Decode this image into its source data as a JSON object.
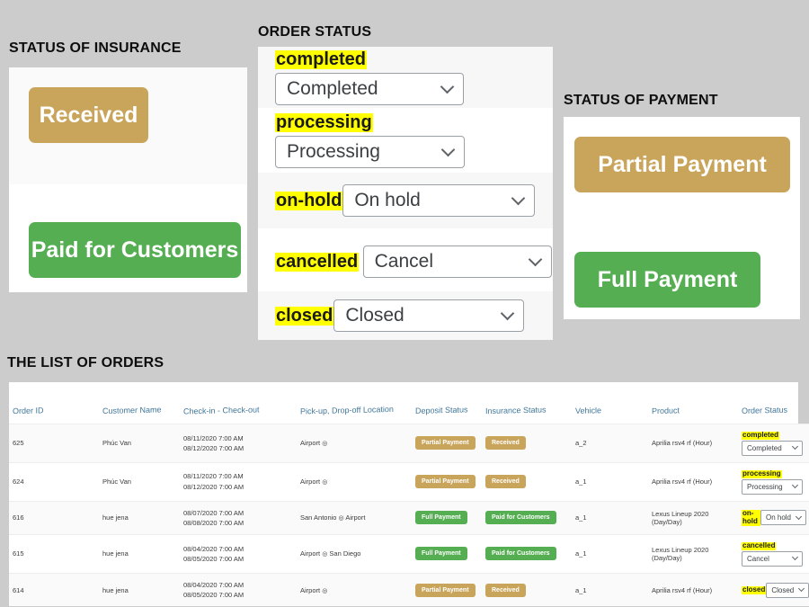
{
  "background_color": "#cccccc",
  "accent_colors": {
    "tan": "#c9a55c",
    "green": "#55ae52",
    "highlight": "#ffff00",
    "link": "#2f6f9f",
    "header_text": "#3f7699"
  },
  "sections": {
    "insurance": {
      "title": "STATUS OF INSURANCE",
      "badges": [
        {
          "label": "Received",
          "color": "tan"
        },
        {
          "label": "Paid for Customers",
          "color": "green"
        }
      ]
    },
    "order_status": {
      "title": "ORDER STATUS",
      "rows": [
        {
          "key": "completed",
          "selected": "Completed",
          "layout": "stack"
        },
        {
          "key": "processing",
          "selected": "Processing",
          "layout": "stack"
        },
        {
          "key": "on-hold",
          "selected": "On hold",
          "layout": "inline"
        },
        {
          "key": "cancelled",
          "selected": "Cancel",
          "layout": "stack"
        },
        {
          "key": "closed",
          "selected": "Closed",
          "layout": "inline"
        }
      ]
    },
    "payment": {
      "title": "STATUS OF PAYMENT",
      "badges": [
        {
          "label": "Partial Payment",
          "color": "tan"
        },
        {
          "label": "Full Payment",
          "color": "green"
        }
      ]
    },
    "orders": {
      "title": "THE LIST OF ORDERS",
      "columns": [
        "Order ID",
        "Customer Name",
        "Check-in - Check-out",
        "Pick-up, Drop-off Location",
        "Deposit Status",
        "Insurance Status",
        "Vehicle",
        "Product",
        "Order Status"
      ],
      "rows": [
        {
          "order_id": "625",
          "customer_name": "Phúc Van",
          "checkin": "08/11/2020 7:00 AM",
          "checkout": "08/12/2020 7:00 AM",
          "location": "Airport",
          "deposit_status": "Partial Payment",
          "deposit_color": "tan",
          "insurance_status": "Received",
          "insurance_color": "tan",
          "vehicle": "a_2",
          "product": "Aprilia rsv4 rf (Hour)",
          "order_status_key": "completed",
          "order_status_value": "Completed",
          "order_status_layout": "stack"
        },
        {
          "order_id": "624",
          "customer_name": "Phúc Van",
          "checkin": "08/11/2020 7:00 AM",
          "checkout": "08/12/2020 7:00 AM",
          "location": "Airport",
          "deposit_status": "Partial Payment",
          "deposit_color": "tan",
          "insurance_status": "Received",
          "insurance_color": "tan",
          "vehicle": "a_1",
          "product": "Aprilia rsv4 rf (Hour)",
          "order_status_key": "processing",
          "order_status_value": "Processing",
          "order_status_layout": "stack"
        },
        {
          "order_id": "616",
          "customer_name": "hue jena",
          "checkin": "08/07/2020 7:00 AM",
          "checkout": "08/08/2020 7:00 AM",
          "location": "San Antonio",
          "location2": "Airport",
          "deposit_status": "Full Payment",
          "deposit_color": "green",
          "insurance_status": "Paid for Customers",
          "insurance_color": "green",
          "vehicle": "a_1",
          "product": "Lexus Lineup 2020 (Day/Day)",
          "order_status_key": "on-hold",
          "order_status_value": "On hold",
          "order_status_layout": "inline"
        },
        {
          "order_id": "615",
          "customer_name": "hue jena",
          "checkin": "08/04/2020 7:00 AM",
          "checkout": "08/05/2020 7:00 AM",
          "location": "Airport",
          "location2": "San Diego",
          "deposit_status": "Full Payment",
          "deposit_color": "green",
          "insurance_status": "Paid for Customers",
          "insurance_color": "green",
          "vehicle": "a_1",
          "product": "Lexus Lineup 2020 (Day/Day)",
          "order_status_key": "cancelled",
          "order_status_value": "Cancel",
          "order_status_layout": "stack"
        },
        {
          "order_id": "614",
          "customer_name": "hue jena",
          "checkin": "08/04/2020 7:00 AM",
          "checkout": "08/05/2020 7:00 AM",
          "location": "Airport",
          "deposit_status": "Partial Payment",
          "deposit_color": "tan",
          "insurance_status": "Received",
          "insurance_color": "tan",
          "vehicle": "a_1",
          "product": "Aprilia rsv4 rf (Hour)",
          "order_status_key": "closed",
          "order_status_value": "Closed",
          "order_status_layout": "inline"
        }
      ]
    }
  }
}
